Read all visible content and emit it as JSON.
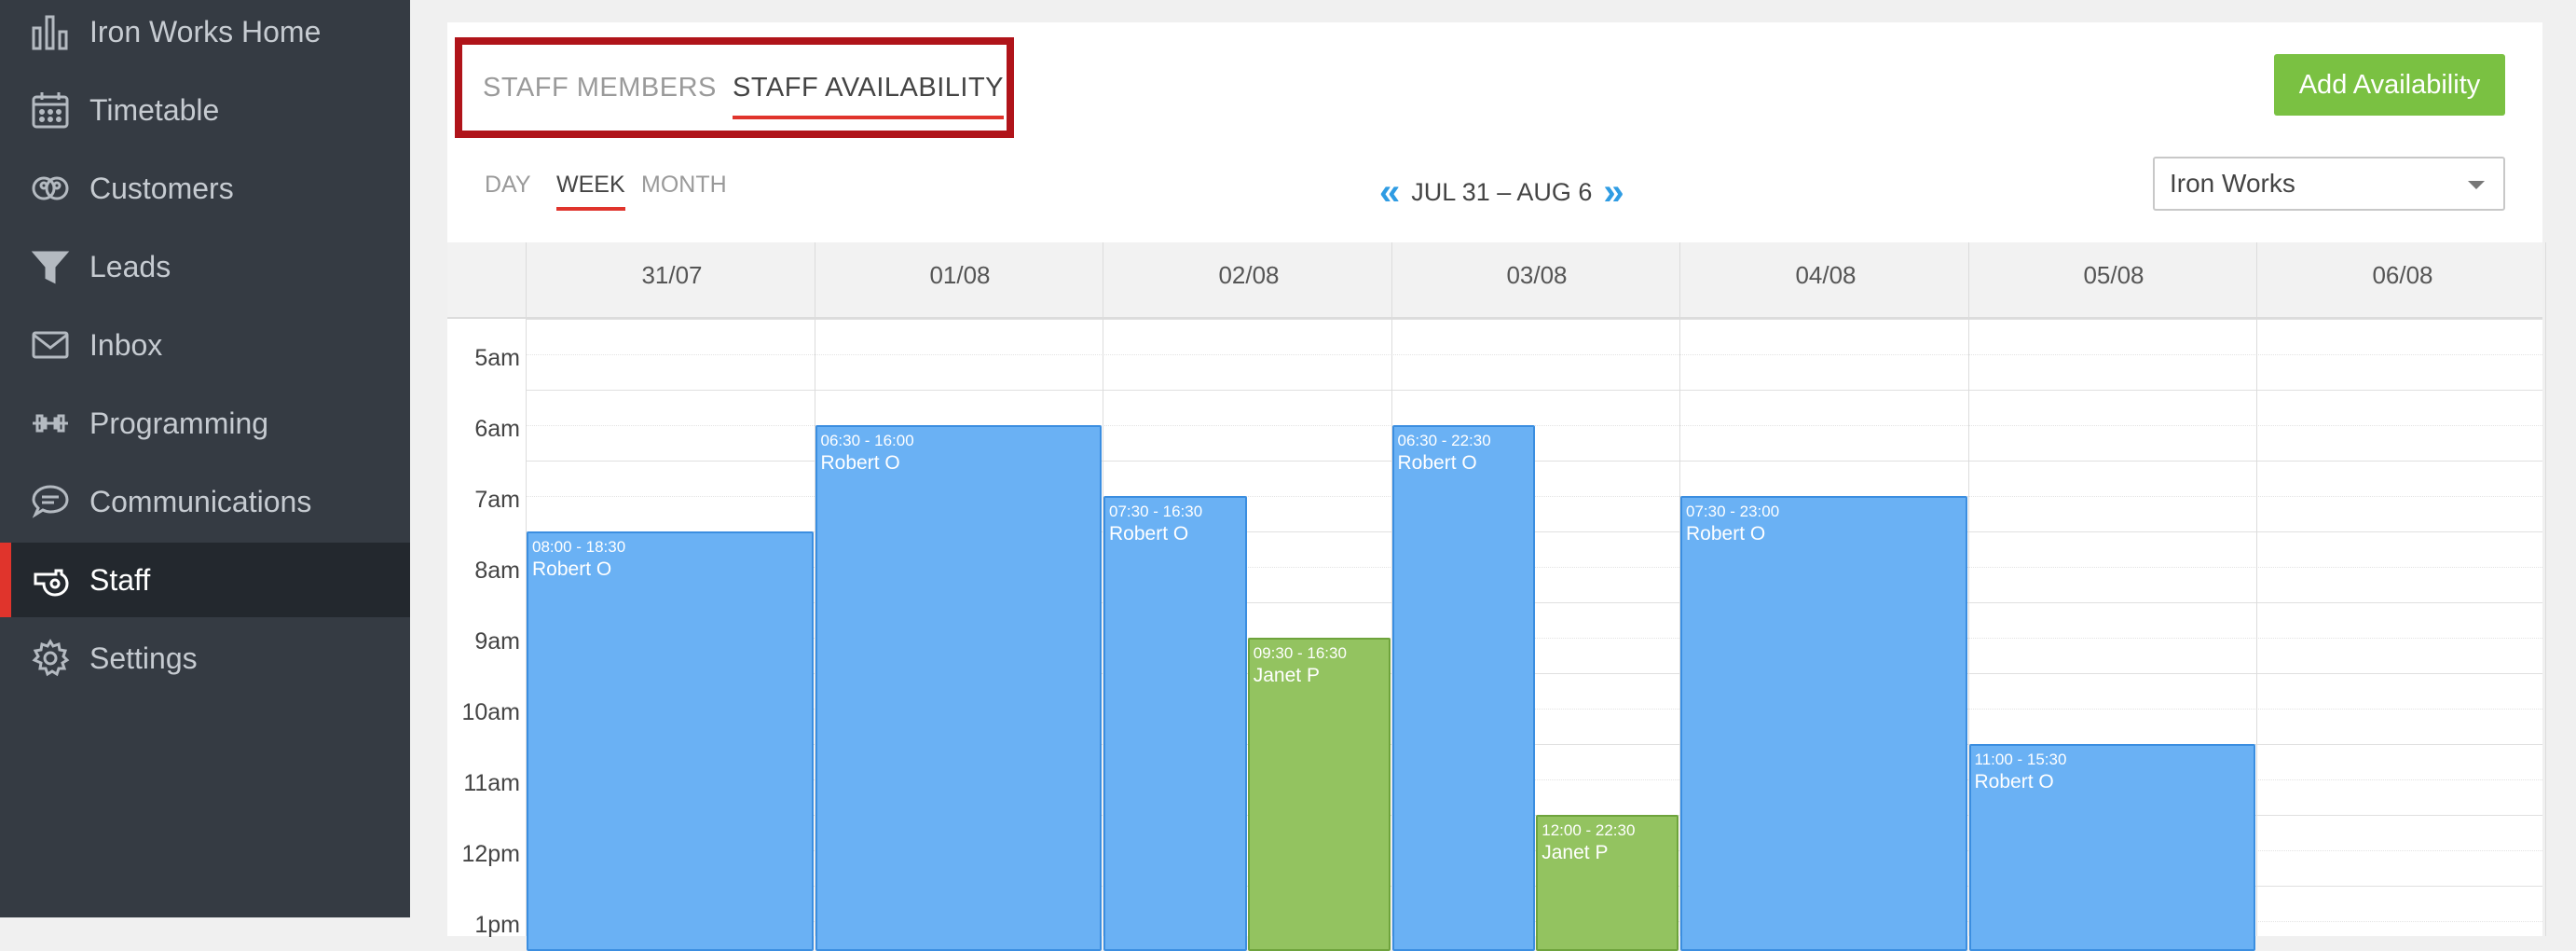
{
  "sidebar": {
    "items": [
      {
        "label": "Iron Works Home",
        "icon": "bar-chart-icon",
        "active": false
      },
      {
        "label": "Timetable",
        "icon": "calendar-icon",
        "active": false
      },
      {
        "label": "Customers",
        "icon": "users-icon",
        "active": false
      },
      {
        "label": "Leads",
        "icon": "funnel-icon",
        "active": false
      },
      {
        "label": "Inbox",
        "icon": "mail-icon",
        "active": false
      },
      {
        "label": "Programming",
        "icon": "dumbbell-icon",
        "active": false
      },
      {
        "label": "Communications",
        "icon": "chat-bubble-icon",
        "active": false
      },
      {
        "label": "Staff",
        "icon": "whistle-icon",
        "active": true
      },
      {
        "label": "Settings",
        "icon": "gear-icon",
        "active": false
      }
    ]
  },
  "tabs": {
    "members": "STAFF MEMBERS",
    "availability": "STAFF AVAILABILITY",
    "active": "availability"
  },
  "add_button": "Add Availability",
  "views": {
    "day": "DAY",
    "week": "WEEK",
    "month": "MONTH",
    "active": "week"
  },
  "date_nav": {
    "prev_icon": "double-chevron-left-icon",
    "range": "JUL 31 – AUG 6",
    "next_icon": "double-chevron-right-icon"
  },
  "location": "Iron Works",
  "calendar": {
    "days": [
      "31/07",
      "01/08",
      "02/08",
      "03/08",
      "04/08",
      "05/08",
      "06/08"
    ],
    "hours": [
      "5am",
      "6am",
      "7am",
      "8am",
      "9am",
      "10am",
      "11am",
      "12pm",
      "1pm"
    ],
    "events": [
      {
        "day": 0,
        "time": "08:00 - 18:30",
        "name": "Robert O",
        "start": 8.0,
        "end": 18.5,
        "color": "blue",
        "sub": "full"
      },
      {
        "day": 1,
        "time": "06:30 - 16:00",
        "name": "Robert O",
        "start": 6.5,
        "end": 16.0,
        "color": "blue",
        "sub": "full"
      },
      {
        "day": 2,
        "time": "07:30 - 16:30",
        "name": "Robert O",
        "start": 7.5,
        "end": 16.5,
        "color": "blue",
        "sub": "left"
      },
      {
        "day": 2,
        "time": "09:30 - 16:30",
        "name": "Janet P",
        "start": 9.5,
        "end": 16.5,
        "color": "green",
        "sub": "right"
      },
      {
        "day": 3,
        "time": "06:30 - 22:30",
        "name": "Robert O",
        "start": 6.5,
        "end": 22.5,
        "color": "blue",
        "sub": "left"
      },
      {
        "day": 3,
        "time": "12:00 - 22:30",
        "name": "Janet P",
        "start": 12.0,
        "end": 22.5,
        "color": "green",
        "sub": "right"
      },
      {
        "day": 4,
        "time": "07:30 - 23:00",
        "name": "Robert O",
        "start": 7.5,
        "end": 23.0,
        "color": "blue",
        "sub": "full"
      },
      {
        "day": 5,
        "time": "11:00 - 15:30",
        "name": "Robert O",
        "start": 11.0,
        "end": 15.5,
        "color": "blue",
        "sub": "full"
      }
    ]
  },
  "colors": {
    "accent_red": "#e0342c",
    "add_green": "#7ac142",
    "event_blue": "#6ab1f4",
    "event_green": "#93c360",
    "nav_arrow": "#2f9ce3"
  }
}
